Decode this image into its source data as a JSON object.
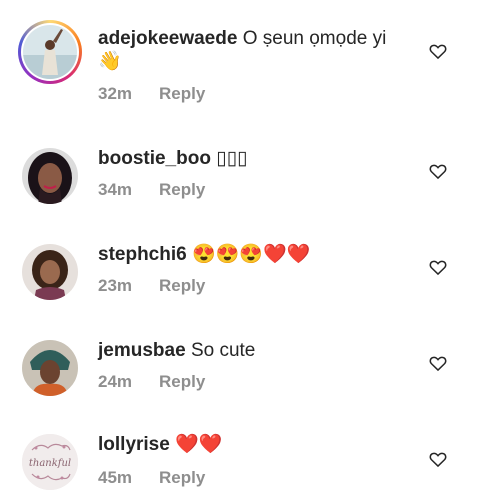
{
  "comments": [
    {
      "username": "adejokeewaede",
      "text": "O ṣeun ọmọde yi",
      "text_line2": "👋",
      "time": "32m",
      "reply_label": "Reply"
    },
    {
      "username": "boostie_boo",
      "text": "▯▯▯",
      "time": "34m",
      "reply_label": "Reply"
    },
    {
      "username": "stephchi6",
      "text": "😍😍😍❤️❤️",
      "time": "23m",
      "reply_label": "Reply"
    },
    {
      "username": "jemusbae",
      "text": "So cute",
      "time": "24m",
      "reply_label": "Reply"
    },
    {
      "username": "lollyrise",
      "text": "❤️❤️",
      "time": "45m",
      "reply_label": "Reply",
      "avatar_text": "thankful"
    }
  ],
  "icons": {
    "like": "heart-outline-icon"
  },
  "colors": {
    "text": "#262626",
    "muted": "#8e8e8e"
  }
}
